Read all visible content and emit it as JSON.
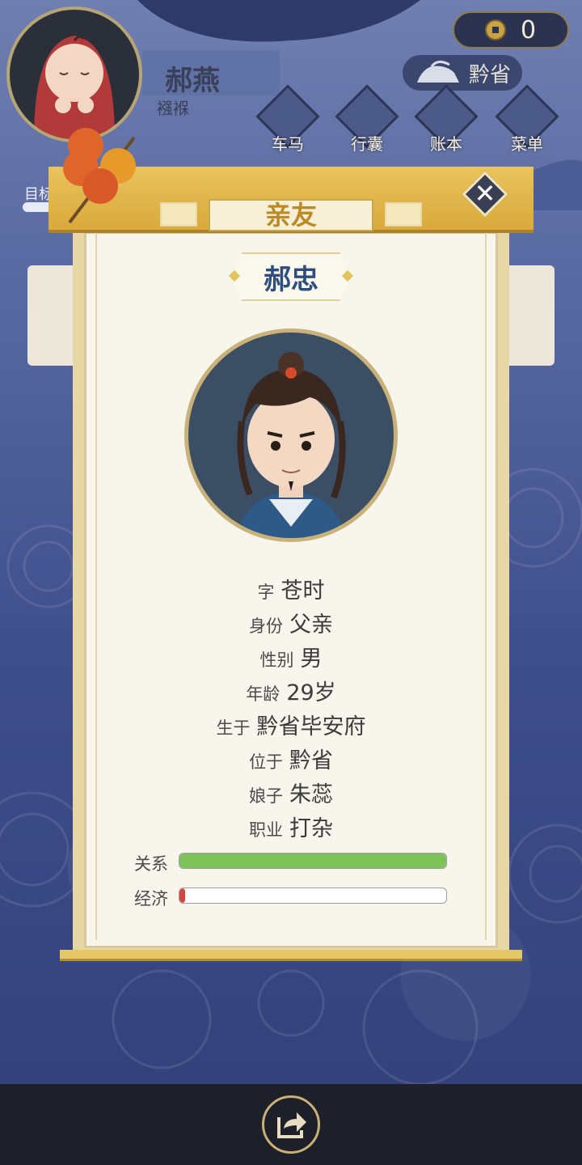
{
  "hud": {
    "player_name": "郝燕",
    "player_stage": "襁褓",
    "coins": "0",
    "location": "黔省",
    "buttons": [
      {
        "label": "车马",
        "icon": "carriage-icon"
      },
      {
        "label": "行囊",
        "icon": "bundle-icon"
      },
      {
        "label": "账本",
        "icon": "ledger-icon"
      },
      {
        "label": "菜单",
        "icon": "more-icon"
      }
    ],
    "goal_label": "目标"
  },
  "dialog": {
    "title": "亲友",
    "character_name": "郝忠",
    "info": [
      {
        "key": "字",
        "value": "苍时"
      },
      {
        "key": "身份",
        "value": "父亲"
      },
      {
        "key": "性别",
        "value": "男"
      },
      {
        "key": "年龄",
        "value": "29岁"
      },
      {
        "key": "生于",
        "value": "黔省毕安府"
      },
      {
        "key": "位于",
        "value": "黔省"
      },
      {
        "key": "娘子",
        "value": "朱蕊"
      },
      {
        "key": "职业",
        "value": "打杂"
      }
    ],
    "bars": [
      {
        "label": "关系",
        "fraction": 1.0,
        "color": "#7ec25a"
      },
      {
        "label": "经济",
        "fraction": 0.02,
        "color": "#d2483a"
      }
    ]
  },
  "colors": {
    "accent_gold": "#d9a93a",
    "name_blue": "#2e4f7c"
  }
}
